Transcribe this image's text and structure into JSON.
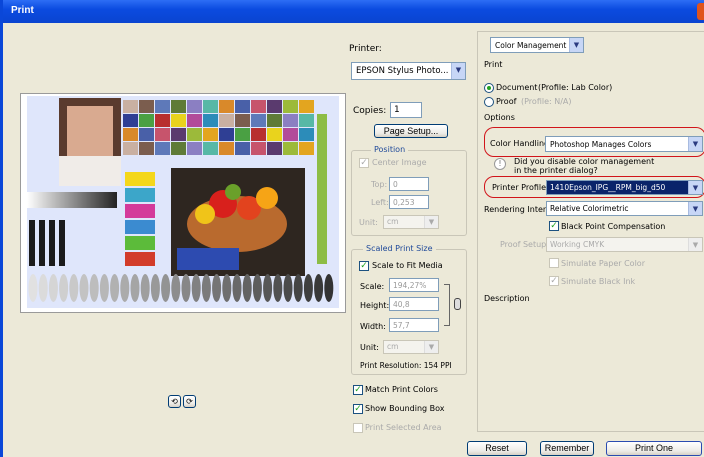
{
  "window": {
    "title": "Print"
  },
  "printer": {
    "label": "Printer:",
    "value": "EPSON Stylus Photo..."
  },
  "copies": {
    "label": "Copies:",
    "value": "1"
  },
  "page_setup_label": "Page Setup...",
  "position": {
    "title": "Position",
    "center_image": "Center Image",
    "top_label": "Top:",
    "top_value": "0",
    "left_label": "Left:",
    "left_value": "0,253",
    "unit_label": "Unit:",
    "unit_value": "cm"
  },
  "scaled": {
    "title": "Scaled Print Size",
    "scale_to_fit": "Scale to Fit Media",
    "scale_label": "Scale:",
    "scale_value": "194,27%",
    "height_label": "Height:",
    "height_value": "40,8",
    "width_label": "Width:",
    "width_value": "57,7",
    "unit_label": "Unit:",
    "unit_value": "cm",
    "resolution": "Print Resolution: 154 PPI"
  },
  "checks": {
    "match_print_colors": "Match Print Colors",
    "show_bounding_box": "Show Bounding Box",
    "print_selected_area": "Print Selected Area"
  },
  "right": {
    "mode_select": "Color Management",
    "print_heading": "Print",
    "document_label": "Document",
    "document_profile": "(Profile: Lab Color)",
    "proof_label": "Proof",
    "proof_profile": "(Profile: N/A)",
    "options_heading": "Options",
    "color_handling_label": "Color Handling:",
    "color_handling_value": "Photoshop Manages Colors",
    "warning_line1": "Did you disable color management",
    "warning_line2": "in the printer dialog?",
    "printer_profile_label": "Printer Profile:",
    "printer_profile_value": "1410Epson_IPG__RPM_big_d50",
    "rendering_intent_label": "Rendering Intent:",
    "rendering_intent_value": "Relative Colorimetric",
    "black_point": "Black Point Compensation",
    "proof_setup_label": "Proof Setup:",
    "proof_setup_value": "Working CMYK",
    "simulate_paper": "Simulate Paper Color",
    "simulate_ink": "Simulate Black Ink",
    "description_heading": "Description"
  },
  "buttons": {
    "reset": "Reset",
    "remember": "Remember",
    "print_one": "Print One"
  },
  "colors": {
    "title_bar": "#0b4be0",
    "highlight": "#d1141a",
    "selection": "#0a246a"
  }
}
